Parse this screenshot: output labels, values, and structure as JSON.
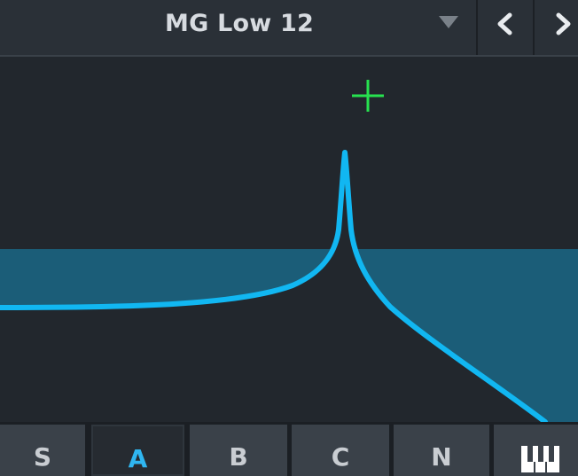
{
  "header": {
    "preset_name": "MG Low 12",
    "dropdown_icon": "triangle-down-icon",
    "prev_icon": "chevron-left-icon",
    "next_icon": "chevron-right-icon"
  },
  "graph": {
    "marker_icon": "crosshair-plus-icon",
    "colors": {
      "curve": "#11b7f2",
      "fill": "#1b5d78",
      "marker": "#27e24f"
    }
  },
  "tabs": [
    {
      "id": "s",
      "label": "S",
      "active": false
    },
    {
      "id": "a",
      "label": "A",
      "active": true
    },
    {
      "id": "b",
      "label": "B",
      "active": false
    },
    {
      "id": "c",
      "label": "C",
      "active": false
    },
    {
      "id": "n",
      "label": "N",
      "active": false
    },
    {
      "id": "keys",
      "label": "",
      "icon": "piano-keys-icon",
      "active": false
    }
  ],
  "colors": {
    "background": "#22272d",
    "header": "#2a3037",
    "tab": "#3a4149",
    "tab_active_text": "#2fb6f0",
    "text": "#d7dbe0"
  }
}
